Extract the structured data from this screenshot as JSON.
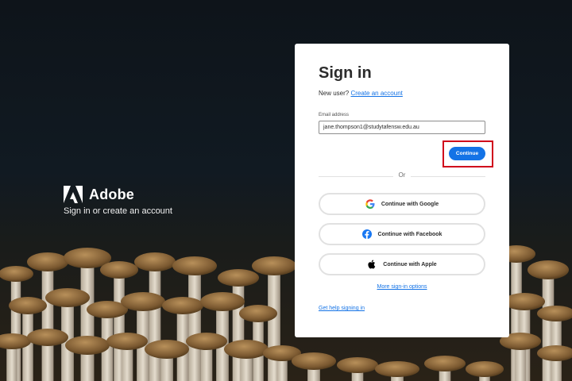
{
  "brand": {
    "name": "Adobe",
    "tagline": "Sign in or create an account",
    "logo_icon": "adobe-logo-icon"
  },
  "signin": {
    "title": "Sign in",
    "new_user_text": "New user?",
    "create_account_link": "Create an account",
    "email_label": "Email address",
    "email_value": "jane.thompson1@studytafensw.edu.au",
    "continue_label": "Continue",
    "or_text": "Or",
    "google_label": "Continue with Google",
    "facebook_label": "Continue with Facebook",
    "apple_label": "Continue with Apple",
    "more_options_link": "More sign-in options",
    "help_link": "Get help signing in"
  },
  "colors": {
    "accent": "#1473e6",
    "highlight": "#d0021b",
    "facebook": "#1877f2"
  }
}
